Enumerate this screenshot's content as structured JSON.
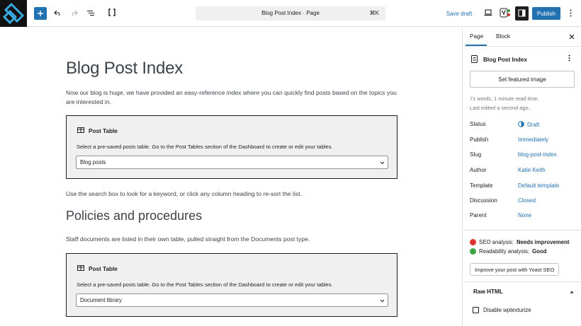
{
  "colors": {
    "accent": "#2271b1",
    "dark": "#1e1e1e",
    "border": "#e0e0e0",
    "muted": "#757575",
    "seo_bad": "#dc3232",
    "seo_good": "#3fa443"
  },
  "toolbar": {
    "logo_icon": "site-logo-icon",
    "add_icon": "plus-icon",
    "undo_icon": "undo-icon",
    "redo_icon": "redo-icon",
    "outline_icon": "list-view-icon",
    "mode_icon": "code-brackets-icon",
    "command_title": "Blog Post Index · Page",
    "command_shortcut": "⌘K",
    "save_draft": "Save draft",
    "preview_icon": "desktop-icon",
    "yoast_icon": "yoast-icon",
    "settings_icon": "sidebar-toggle-icon",
    "publish": "Publish",
    "options_icon": "more-vertical-icon"
  },
  "editor": {
    "title": "Blog Post Index",
    "intro": "Now our blog is huge, we have provided an easy-reference index where you can quickly find posts based on the topics you are interested in.",
    "post_tables": [
      {
        "label": "Post Table",
        "help": "Select a pre-saved posts table. Go to the Post Tables section of the Dashboard to create or edit your tables.",
        "selected": "Blog posts"
      },
      {
        "label": "Post Table",
        "help": "Select a pre-saved posts table. Go to the Post Tables section of the Dashboard to create or edit your tables.",
        "selected": "Document library"
      }
    ],
    "search_hint": "Use the search box to look for a keyword, or click any column heading to re-sort the list.",
    "heading2": "Policies and procedures",
    "staff_para": "Staff documents are listed in their own table, pulled straight from the Documents post type."
  },
  "sidebar": {
    "tabs": [
      "Page",
      "Block"
    ],
    "active_tab": "Page",
    "close_icon": "close-icon",
    "doc_title": "Blog Post Index",
    "doc_icon": "page-icon",
    "featured_image": "Set featured image",
    "word_count": "71 words, 1 minute read time.",
    "last_edited": "Last edited a second ago.",
    "fields": [
      {
        "label": "Status",
        "value": "Draft"
      },
      {
        "label": "Publish",
        "value": "Immediately"
      },
      {
        "label": "Slug",
        "value": "blog-post-index"
      },
      {
        "label": "Author",
        "value": "Katie Keith"
      },
      {
        "label": "Template",
        "value": "Default template"
      },
      {
        "label": "Discussion",
        "value": "Closed"
      },
      {
        "label": "Parent",
        "value": "None"
      }
    ],
    "seo": {
      "label": "SEO analysis:",
      "value": "Needs improvement"
    },
    "readability": {
      "label": "Readability analysis:",
      "value": "Good"
    },
    "yoast_button": "Improve your post with Yoast SEO",
    "raw_html": "Raw HTML",
    "wptexturize": "Disable wptexturize"
  }
}
